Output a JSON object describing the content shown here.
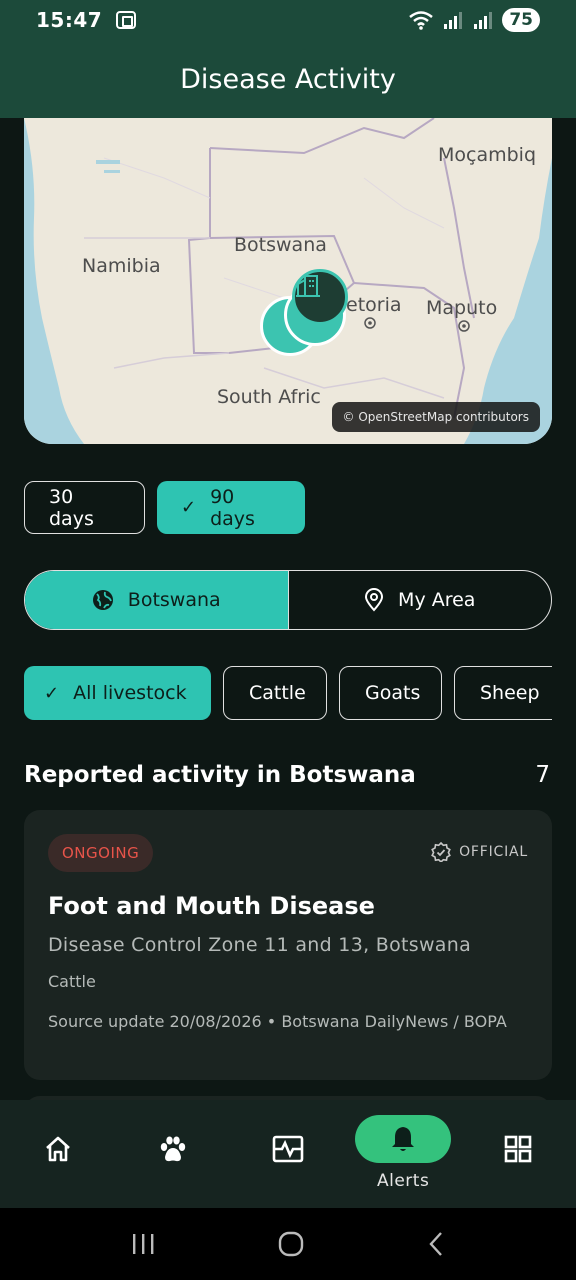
{
  "status_bar": {
    "time": "15:47",
    "battery": "75",
    "icons": [
      "screenshot-icon",
      "wifi-icon",
      "signal-icon",
      "signal-icon"
    ]
  },
  "app_bar": {
    "title": "Disease Activity"
  },
  "map": {
    "labels": {
      "botswana": "Botswana",
      "namibia": "Namibia",
      "mocambique": "Moçambiq",
      "pretoria": "etoria",
      "maputo": "Maputo",
      "south_africa": "South Afric"
    },
    "attribution": "© OpenStreetMap contributors",
    "colors": {
      "land": "#ede8dc",
      "water": "#aad3df",
      "cluster": "#3cc4b0",
      "pin": "#1e3d33"
    }
  },
  "day_filters": [
    {
      "label": "30 days",
      "selected": false
    },
    {
      "label": "90 days",
      "selected": true
    }
  ],
  "region_toggle": {
    "botswana_label": "Botswana",
    "my_area_label": "My Area",
    "selected": "Botswana"
  },
  "livestock_filters": [
    {
      "label": "All livestock",
      "selected": true
    },
    {
      "label": "Cattle",
      "selected": false
    },
    {
      "label": "Goats",
      "selected": false
    },
    {
      "label": "Sheep",
      "selected": false
    }
  ],
  "section": {
    "title": "Reported activity in Botswana",
    "count": "7"
  },
  "report_card": {
    "status": "ONGOING",
    "official_label": "OFFICIAL",
    "title": "Foot and Mouth Disease",
    "location": "Disease Control Zone 11 and 13, Botswana",
    "livestock": "Cattle",
    "source": "Source update 20/08/2026 • Botswana DailyNews / BOPA"
  },
  "bottom_nav": {
    "items": [
      {
        "icon": "home-icon",
        "label": ""
      },
      {
        "icon": "paw-icon",
        "label": ""
      },
      {
        "icon": "activity-icon",
        "label": ""
      },
      {
        "icon": "bell-icon",
        "label": "Alerts",
        "active": true
      },
      {
        "icon": "grid-icon",
        "label": ""
      }
    ]
  },
  "colors": {
    "header": "#1c4a3a",
    "accent": "#2ec4b2",
    "nav_active": "#34c27d",
    "background": "#0d1714",
    "card": "#1b2421",
    "ongoing": "#e8544a"
  }
}
